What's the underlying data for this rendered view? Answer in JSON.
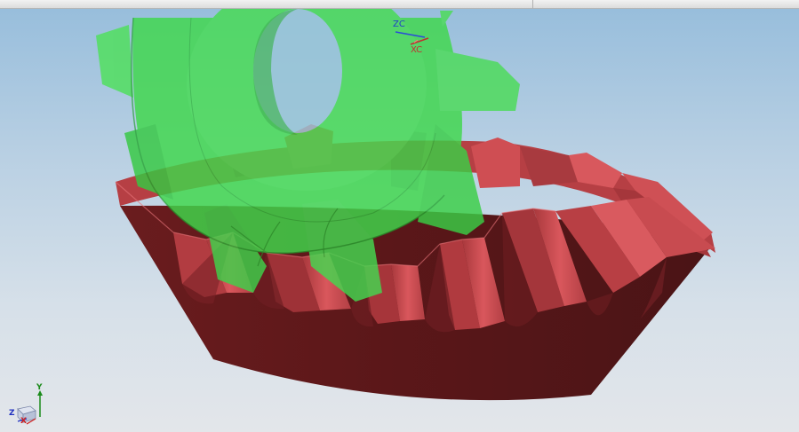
{
  "window": {
    "title_bar": ""
  },
  "viewport": {
    "background_top": "#98bedc",
    "background_bottom": "#e3e6ea",
    "work_csys": {
      "z_label": "ZC",
      "x_label": "XC",
      "z_color": "#1f3fc8",
      "x_color": "#c03030"
    },
    "view_triad": {
      "x_label": "X",
      "y_label": "Y",
      "z_label": "Z",
      "x_color": "#d02020",
      "y_color": "#1a8a1a",
      "z_color": "#2030c0"
    },
    "models": [
      {
        "name": "bevel-gear",
        "color": "#cf4a4f"
      },
      {
        "name": "pinion-gear",
        "color": "#3ed84a"
      }
    ]
  }
}
